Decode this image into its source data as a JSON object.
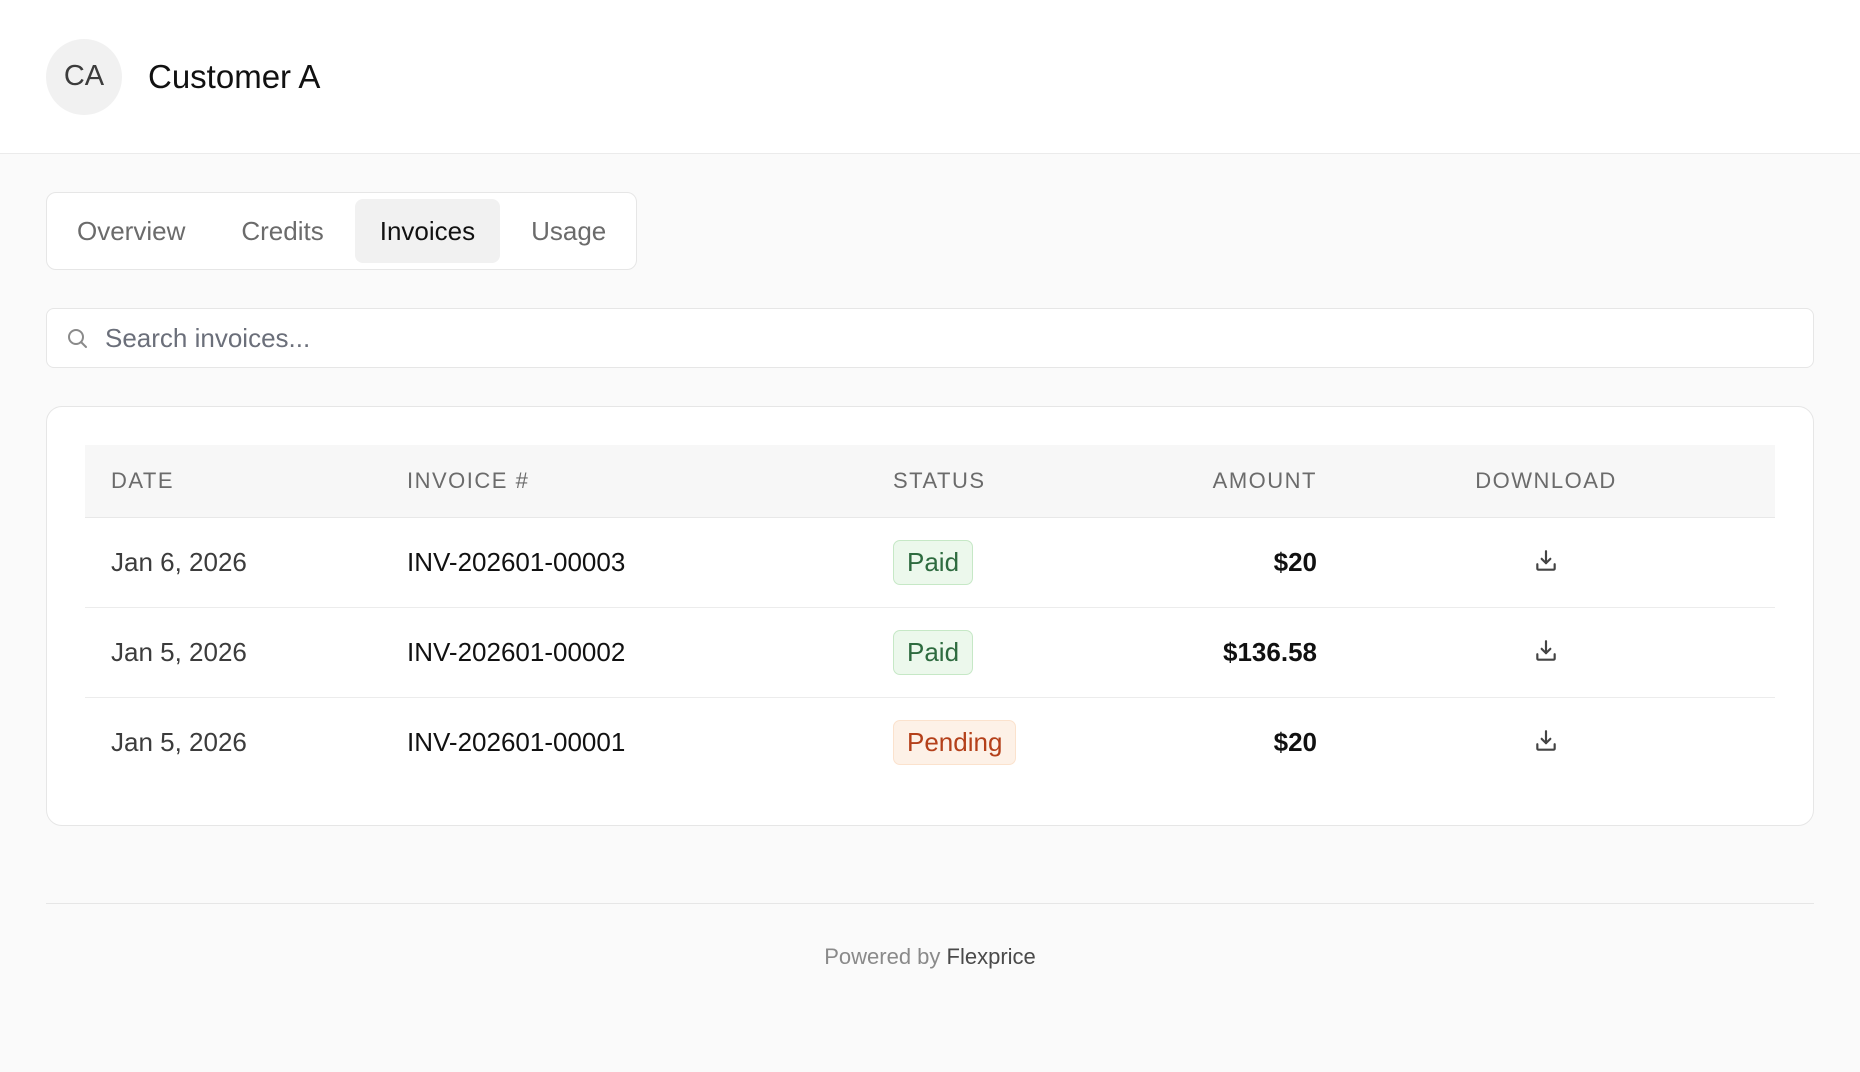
{
  "header": {
    "avatar_initials": "CA",
    "customer_name": "Customer A"
  },
  "tabs": [
    {
      "label": "Overview",
      "active": false
    },
    {
      "label": "Credits",
      "active": false
    },
    {
      "label": "Invoices",
      "active": true
    },
    {
      "label": "Usage",
      "active": false
    }
  ],
  "search": {
    "placeholder": "Search invoices...",
    "value": "",
    "icon": "search-icon"
  },
  "table": {
    "columns": {
      "date": "DATE",
      "invoice": "INVOICE #",
      "status": "STATUS",
      "amount": "AMOUNT",
      "download": "DOWNLOAD"
    },
    "rows": [
      {
        "date": "Jan 6, 2026",
        "invoice": "INV-202601-00003",
        "status": "Paid",
        "status_type": "paid",
        "amount": "$20",
        "download_icon": "download-icon"
      },
      {
        "date": "Jan 5, 2026",
        "invoice": "INV-202601-00002",
        "status": "Paid",
        "status_type": "paid",
        "amount": "$136.58",
        "download_icon": "download-icon"
      },
      {
        "date": "Jan 5, 2026",
        "invoice": "INV-202601-00001",
        "status": "Pending",
        "status_type": "pending",
        "amount": "$20",
        "download_icon": "download-icon"
      }
    ]
  },
  "footer": {
    "prefix": "Powered by",
    "brand": "Flexprice"
  },
  "colors": {
    "paid_bg": "#ecf8ec",
    "paid_text": "#2e6b3f",
    "pending_bg": "#fdf1e7",
    "pending_text": "#b4401a",
    "active_tab_bg": "#f1f1f1"
  }
}
